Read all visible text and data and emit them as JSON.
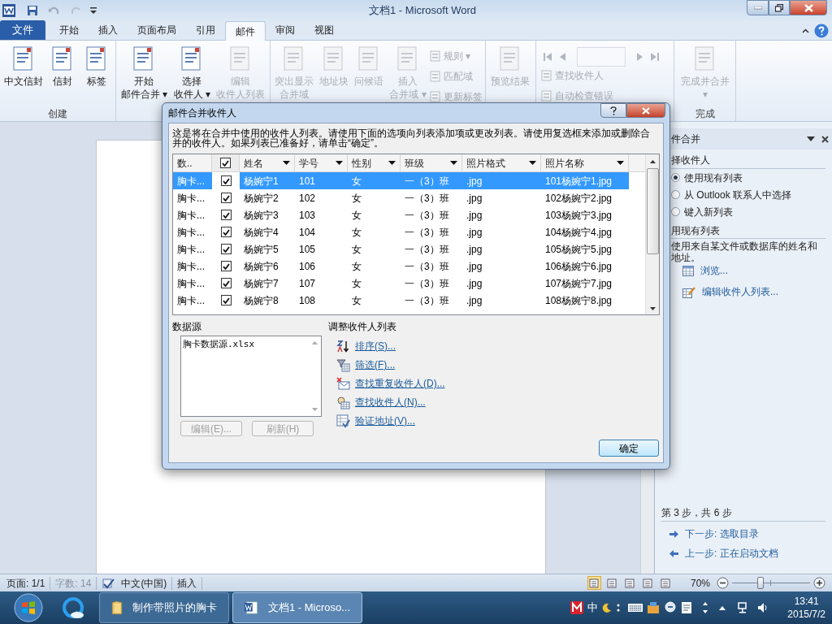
{
  "window": {
    "title": "文档1 - Microsoft Word"
  },
  "tabs": [
    {
      "label": "文件",
      "kind": "file",
      "selected": false
    },
    {
      "label": "开始",
      "kind": "tab",
      "selected": false
    },
    {
      "label": "插入",
      "kind": "tab",
      "selected": false
    },
    {
      "label": "页面布局",
      "kind": "tab",
      "selected": false
    },
    {
      "label": "引用",
      "kind": "tab",
      "selected": false
    },
    {
      "label": "邮件",
      "kind": "tab",
      "selected": true
    },
    {
      "label": "审阅",
      "kind": "tab",
      "selected": false
    },
    {
      "label": "视图",
      "kind": "tab",
      "selected": false
    }
  ],
  "ribbon": {
    "groups": [
      {
        "label": "创建",
        "items": [
          {
            "kind": "large",
            "label": "中文信封",
            "disabled": false
          },
          {
            "kind": "large",
            "label": "信封",
            "disabled": false
          },
          {
            "kind": "large",
            "label": "标签",
            "disabled": false
          }
        ]
      },
      {
        "items": [
          {
            "kind": "large",
            "label": "开始",
            "label2": "邮件合并 ▾",
            "disabled": false
          },
          {
            "kind": "large",
            "label": "选择",
            "label2": "收件人 ▾",
            "disabled": false
          },
          {
            "kind": "large",
            "label": "编辑",
            "label2": "收件人列表",
            "disabled": true
          }
        ]
      },
      {
        "items": [
          {
            "kind": "large",
            "label": "突出显示",
            "label2": "合并域",
            "disabled": true
          },
          {
            "kind": "large",
            "label": "地址块",
            "disabled": true
          },
          {
            "kind": "large",
            "label": "问候语",
            "disabled": true
          },
          {
            "kind": "large",
            "label": "插入",
            "label2": "合并域 ▾",
            "disabled": true
          },
          {
            "kind": "stack",
            "items": [
              {
                "label": "规则 ▾",
                "disabled": true
              },
              {
                "label": "匹配域",
                "disabled": true
              },
              {
                "label": "更新标签",
                "disabled": true
              }
            ]
          }
        ]
      },
      {
        "items": [
          {
            "kind": "large",
            "label": "预览结果",
            "disabled": true
          }
        ]
      },
      {
        "items": [
          {
            "kind": "nav",
            "disabled": true
          },
          {
            "kind": "stack",
            "items": [
              {
                "label": "查找收件人",
                "disabled": true
              },
              {
                "label": "自动检查错误",
                "disabled": true
              }
            ]
          }
        ]
      },
      {
        "label": "完成",
        "items": [
          {
            "kind": "large",
            "label": "完成并合并",
            "label2": "▾",
            "disabled": true
          }
        ]
      }
    ]
  },
  "task_pane": {
    "title": "件合并",
    "section1": "择收件人",
    "options": [
      {
        "label": "使用现有列表",
        "selected": true
      },
      {
        "label": "从 Outlook 联系人中选择",
        "selected": false
      },
      {
        "label": "键入新列表",
        "selected": false
      }
    ],
    "section2": "用现有列表",
    "description": "使用来自某文件或数据库的姓名和地址。",
    "links": [
      "浏览...",
      "编辑收件人列表..."
    ],
    "step": "第 3 步，共 6 步",
    "next": "下一步: 选取目录",
    "prev": "上一步: 正在启动文档"
  },
  "dialog": {
    "title": "邮件合并收件人",
    "intro": "这是将在合并中使用的收件人列表。请使用下面的选项向列表添加项或更改列表。请使用复选框来添加或删除合并的收件人。如果列表已准备好，请单击“确定”。",
    "table": {
      "columns": [
        "数..",
        "",
        "姓名",
        "学号",
        "性别",
        "班级",
        "照片格式",
        "照片名称"
      ],
      "header_checked": true,
      "rows": [
        {
          "cells": [
            "胸卡...",
            "",
            "杨婉宁1",
            "101",
            "女",
            "一（3）班",
            ".jpg",
            "101杨婉宁1.jpg"
          ],
          "checked": true,
          "selected": true
        },
        {
          "cells": [
            "胸卡...",
            "",
            "杨婉宁2",
            "102",
            "女",
            "一（3）班",
            ".jpg",
            "102杨婉宁2.jpg"
          ],
          "checked": true,
          "selected": false
        },
        {
          "cells": [
            "胸卡...",
            "",
            "杨婉宁3",
            "103",
            "女",
            "一（3）班",
            ".jpg",
            "103杨婉宁3.jpg"
          ],
          "checked": true,
          "selected": false
        },
        {
          "cells": [
            "胸卡...",
            "",
            "杨婉宁4",
            "104",
            "女",
            "一（3）班",
            ".jpg",
            "104杨婉宁4.jpg"
          ],
          "checked": true,
          "selected": false
        },
        {
          "cells": [
            "胸卡...",
            "",
            "杨婉宁5",
            "105",
            "女",
            "一（3）班",
            ".jpg",
            "105杨婉宁5.jpg"
          ],
          "checked": true,
          "selected": false
        },
        {
          "cells": [
            "胸卡...",
            "",
            "杨婉宁6",
            "106",
            "女",
            "一（3）班",
            ".jpg",
            "106杨婉宁6.jpg"
          ],
          "checked": true,
          "selected": false
        },
        {
          "cells": [
            "胸卡...",
            "",
            "杨婉宁7",
            "107",
            "女",
            "一（3）班",
            ".jpg",
            "107杨婉宁7.jpg"
          ],
          "checked": true,
          "selected": false
        },
        {
          "cells": [
            "胸卡...",
            "",
            "杨婉宁8",
            "108",
            "女",
            "一（3）班",
            ".jpg",
            "108杨婉宁8.jpg"
          ],
          "checked": true,
          "selected": false
        }
      ]
    },
    "source_label": "数据源",
    "sources": [
      "胸卡数据源.xlsx"
    ],
    "source_buttons": [
      {
        "label": "编辑(E)...",
        "disabled": true
      },
      {
        "label": "刷新(H)",
        "disabled": true
      }
    ],
    "adjust_label": "调整收件人列表",
    "actions": [
      {
        "kind": "sort",
        "label": "排序(S)..."
      },
      {
        "kind": "filter",
        "label": "筛选(F)..."
      },
      {
        "kind": "dup",
        "label": "查找重复收件人(D)..."
      },
      {
        "kind": "find",
        "label": "查找收件人(N)..."
      },
      {
        "kind": "verify",
        "label": "验证地址(V)..."
      }
    ],
    "ok": "确定"
  },
  "status_bar": {
    "page": "页面: 1/1",
    "words": "字数: 14",
    "language": "中文(中国)",
    "mode": "插入",
    "zoom": "70%",
    "level": 0.36
  },
  "taskbar": {
    "items": [
      {
        "kind": "folder",
        "label": "制作带照片的胸卡",
        "selected": false
      },
      {
        "kind": "word",
        "label": "文档1 - Microso...",
        "selected": true
      }
    ],
    "tray": [
      "中"
    ],
    "time": "13:41",
    "date": "2015/7/2"
  }
}
